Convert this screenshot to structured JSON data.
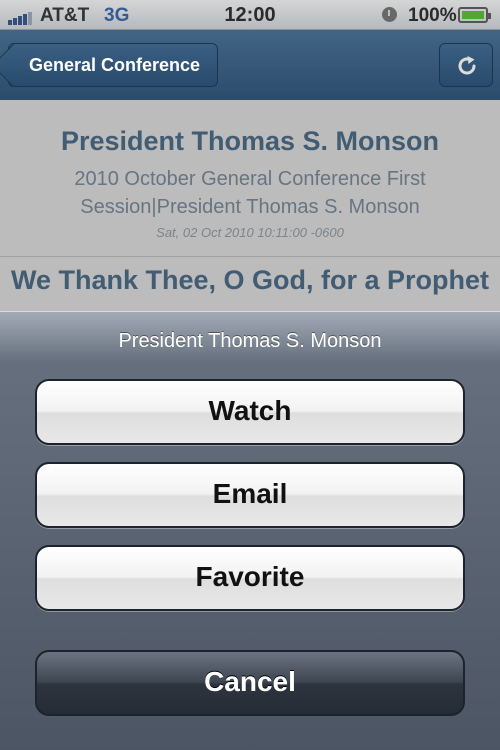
{
  "status_bar": {
    "carrier": "AT&T",
    "network": "3G",
    "time": "12:00",
    "battery": "100%",
    "icons": [
      "signal-bars-icon",
      "rotation-lock-icon",
      "battery-icon"
    ]
  },
  "nav": {
    "back_label": "General Conference",
    "refresh_icon": "refresh-icon"
  },
  "list": {
    "items": [
      {
        "title": "President Thomas S. Monson",
        "subtitle": "2010 October General Conference First Session|President Thomas S. Monson",
        "date": "Sat, 02 Oct 2010 10:11:00 -0600"
      },
      {
        "title": "We Thank Thee, O God, for a Prophet"
      }
    ]
  },
  "action_sheet": {
    "title": "President Thomas S. Monson",
    "buttons": [
      "Watch",
      "Email",
      "Favorite"
    ],
    "cancel": "Cancel"
  },
  "colors": {
    "nav_bar": "#2e5a84",
    "list_title": "#3e5f7c"
  }
}
